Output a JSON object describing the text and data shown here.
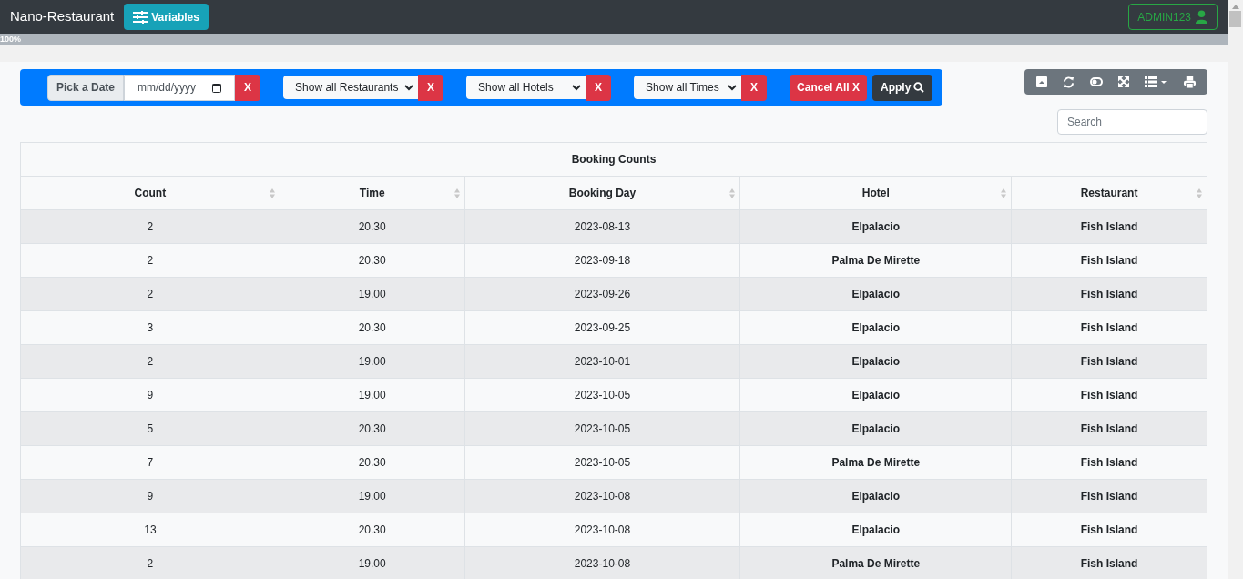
{
  "navbar": {
    "brand": "Nano-Restaurant",
    "variables_button": "Variables",
    "user_button": "ADMIN123"
  },
  "progress": {
    "label": "100%",
    "level": 1
  },
  "filters": {
    "date_label": "Pick a Date",
    "date_placeholder": "mm/dd/yyyy",
    "date_clear": "X",
    "selects": [
      {
        "value": "Show all Restaurants",
        "clear": "X"
      },
      {
        "value": "Show all Hotels",
        "clear": "X"
      },
      {
        "value": "Show all Times",
        "clear": "X"
      }
    ],
    "cancel_all": "Cancel All X",
    "apply": "Apply"
  },
  "search": {
    "placeholder": "Search"
  },
  "table": {
    "caption": "Booking Counts",
    "columns": [
      "Count",
      "Time",
      "Booking Day",
      "Hotel",
      "Restaurant"
    ],
    "rows": [
      [
        "2",
        "20.30",
        "2023-08-13",
        "Elpalacio",
        "Fish Island"
      ],
      [
        "2",
        "20.30",
        "2023-09-18",
        "Palma De Mirette",
        "Fish Island"
      ],
      [
        "2",
        "19.00",
        "2023-09-26",
        "Elpalacio",
        "Fish Island"
      ],
      [
        "3",
        "20.30",
        "2023-09-25",
        "Elpalacio",
        "Fish Island"
      ],
      [
        "2",
        "19.00",
        "2023-10-01",
        "Elpalacio",
        "Fish Island"
      ],
      [
        "9",
        "19.00",
        "2023-10-05",
        "Elpalacio",
        "Fish Island"
      ],
      [
        "5",
        "20.30",
        "2023-10-05",
        "Elpalacio",
        "Fish Island"
      ],
      [
        "7",
        "20.30",
        "2023-10-05",
        "Palma De Mirette",
        "Fish Island"
      ],
      [
        "9",
        "19.00",
        "2023-10-08",
        "Elpalacio",
        "Fish Island"
      ],
      [
        "13",
        "20.30",
        "2023-10-08",
        "Elpalacio",
        "Fish Island"
      ],
      [
        "2",
        "19.00",
        "2023-10-08",
        "Palma De Mirette",
        "Fish Island"
      ]
    ]
  }
}
